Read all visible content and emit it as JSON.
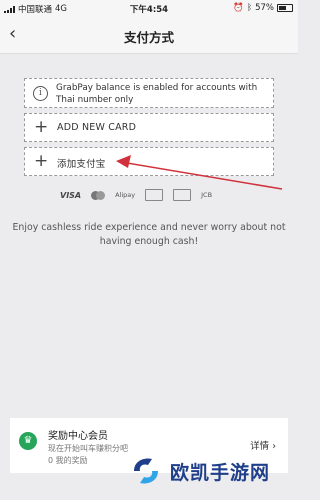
{
  "status_bar": {
    "carrier": "中国联通",
    "network": "4G",
    "time": "下午4:54",
    "battery": "57%"
  },
  "nav": {
    "title": "支付方式",
    "back_icon": "chevron-left-icon"
  },
  "notice": {
    "icon": "info-icon",
    "text": "GrabPay balance is enabled for accounts with Thai number only"
  },
  "options": [
    {
      "label": "ADD NEW CARD",
      "icon": "plus-icon"
    },
    {
      "label": "添加支付宝",
      "icon": "plus-icon"
    }
  ],
  "brands": [
    "VISA",
    "Alipay",
    "AMERICAN EXPRESS",
    "JCB"
  ],
  "tagline": "Enjoy cashless ride experience and never worry about not having enough cash!",
  "reward": {
    "title": "奖励中心会员",
    "subtitle": "现在开始叫车赚积分吧",
    "points": "0 我的奖励",
    "link": "详情 ›"
  },
  "watermark": "欧凯手游网",
  "colors": {
    "accent_green": "#27a55b",
    "arrow_red": "#d0313a",
    "watermark_blue": "#1f3f8a"
  }
}
